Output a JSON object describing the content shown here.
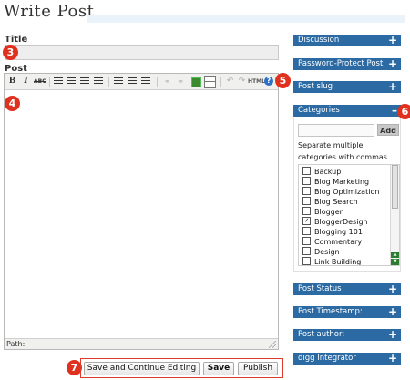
{
  "page": {
    "title": "Write Post"
  },
  "title_field": {
    "label": "Title",
    "value": ""
  },
  "post_field": {
    "label": "Post",
    "content": "",
    "path_label": "Path:"
  },
  "toolbar": {
    "bold": "B",
    "italic": "I",
    "strike": "ABC",
    "html": "HTML",
    "help": "?"
  },
  "badges": [
    "3",
    "4",
    "5",
    "6",
    "7"
  ],
  "actions": {
    "save_continue": "Save and Continue Editing",
    "save": "Save",
    "publish": "Publish"
  },
  "sidebar": {
    "panels_top": [
      {
        "label": "Discussion",
        "toggle": "+"
      },
      {
        "label": "Password-Protect Post",
        "toggle": "+"
      },
      {
        "label": "Post slug",
        "toggle": "+"
      }
    ],
    "categories": {
      "label": "Categories",
      "toggle": "–",
      "add_button": "Add",
      "input_value": "",
      "help": "Separate multiple categories with commas.",
      "items": [
        {
          "label": "Backup",
          "checked": false
        },
        {
          "label": "Blog Marketing",
          "checked": false
        },
        {
          "label": "Blog Optimization",
          "checked": false
        },
        {
          "label": "Blog Search",
          "checked": false
        },
        {
          "label": "Blogger",
          "checked": false
        },
        {
          "label": "BloggerDesign",
          "checked": true
        },
        {
          "label": "Blogging 101",
          "checked": false
        },
        {
          "label": "Commentary",
          "checked": false
        },
        {
          "label": "Design",
          "checked": false
        },
        {
          "label": "Link Building",
          "checked": false
        }
      ]
    },
    "panels_bottom": [
      {
        "label": "Post Status",
        "toggle": "+"
      },
      {
        "label": "Post Timestamp:",
        "toggle": "+"
      },
      {
        "label": "Post author:",
        "toggle": "+"
      },
      {
        "label": "digg Integrator",
        "toggle": "+"
      }
    ]
  },
  "colors": {
    "panel_blue": "#2b6aa3",
    "badge_red": "#e0301e",
    "action_border": "#e03a2a",
    "scroll_arrow_green": "#2c7d32"
  }
}
